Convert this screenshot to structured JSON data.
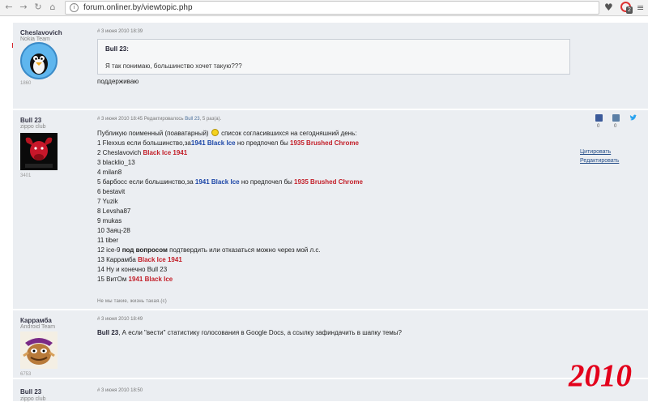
{
  "browser": {
    "url": "forum.onliner.by/viewtopic.php",
    "extension_badge": "2"
  },
  "posts": [
    {
      "username": "Cheslavovich",
      "group": "Nokia Team",
      "post_count": "1860",
      "meta": "# 3 июня 2010 18:39",
      "quote_author": "Bull 23:",
      "quote_text": "Я так понимаю, большинство хочет такую???",
      "text": "поддерживаю"
    },
    {
      "username": "Bull 23",
      "group": "zippo club",
      "post_count": "3401",
      "meta_date": "# 3 июня 2010 18:45",
      "meta_edit": "Редактировалось",
      "meta_by": "Bull 23",
      "meta_times": ", 5 раз(а).",
      "intro_a": "Публикую поименный (поаватарный)",
      "intro_b": "список согласившихся на сегодняшний день:",
      "list": [
        {
          "pre": "1 Flexxus если большинство,за",
          "b1": "1941 Black Ice",
          "mid": " но предпочел бы ",
          "r1": "1935 Brushed Chrome"
        },
        {
          "pre": "2 Cheslavovich ",
          "r1": "Black Ice 1941"
        },
        {
          "pre": "3 blacklio_13"
        },
        {
          "pre": "4 milan8"
        },
        {
          "pre": "5 барбосс если большинство,за ",
          "b1": "1941 Black Ice",
          "mid": " но предпочел бы ",
          "r1": "1935 Brushed Chrome"
        },
        {
          "pre": "6 bestavit"
        },
        {
          "pre": "7 Yuzik"
        },
        {
          "pre": "8 Levsha87"
        },
        {
          "pre": "9 mukas"
        },
        {
          "pre": "10 Заяц-28"
        },
        {
          "pre": "11 tiber"
        },
        {
          "pre": "12 ice-9 ",
          "k1": "под вопросом",
          "mid": " подтвердить или отказаться можно через мой л.с."
        },
        {
          "pre": "13 Каррамба ",
          "r1": "Black Ice 1941"
        },
        {
          "pre": "14 Ну и конечно Bull 23"
        },
        {
          "pre": "15 ВитОм ",
          "r1": "1941 Black Ice"
        }
      ],
      "signature": "Не мы такие, жизнь такая.(с)",
      "share_counts": [
        "0",
        "0"
      ],
      "action_quote": "Цитировать",
      "action_edit": "Редактировать"
    },
    {
      "username": "Каррамба",
      "group": "Android Team",
      "post_count": "6753",
      "meta": "# 3 июня 2010 18:49",
      "mention": "Bull 23",
      "text": ", А если \"вести\" статистику голосования в Google Docs, а ссылку зафиндачить в шапку темы?"
    },
    {
      "username": "Bull 23",
      "group": "zippo club",
      "meta": "# 3 июня 2010 18:50"
    }
  ],
  "overlay_year": "2010",
  "colors": {
    "post_bg": "#ebeef2",
    "link_blue": "#1d47a8",
    "highlight_red": "#c3202a",
    "year_red": "#e3001b"
  }
}
